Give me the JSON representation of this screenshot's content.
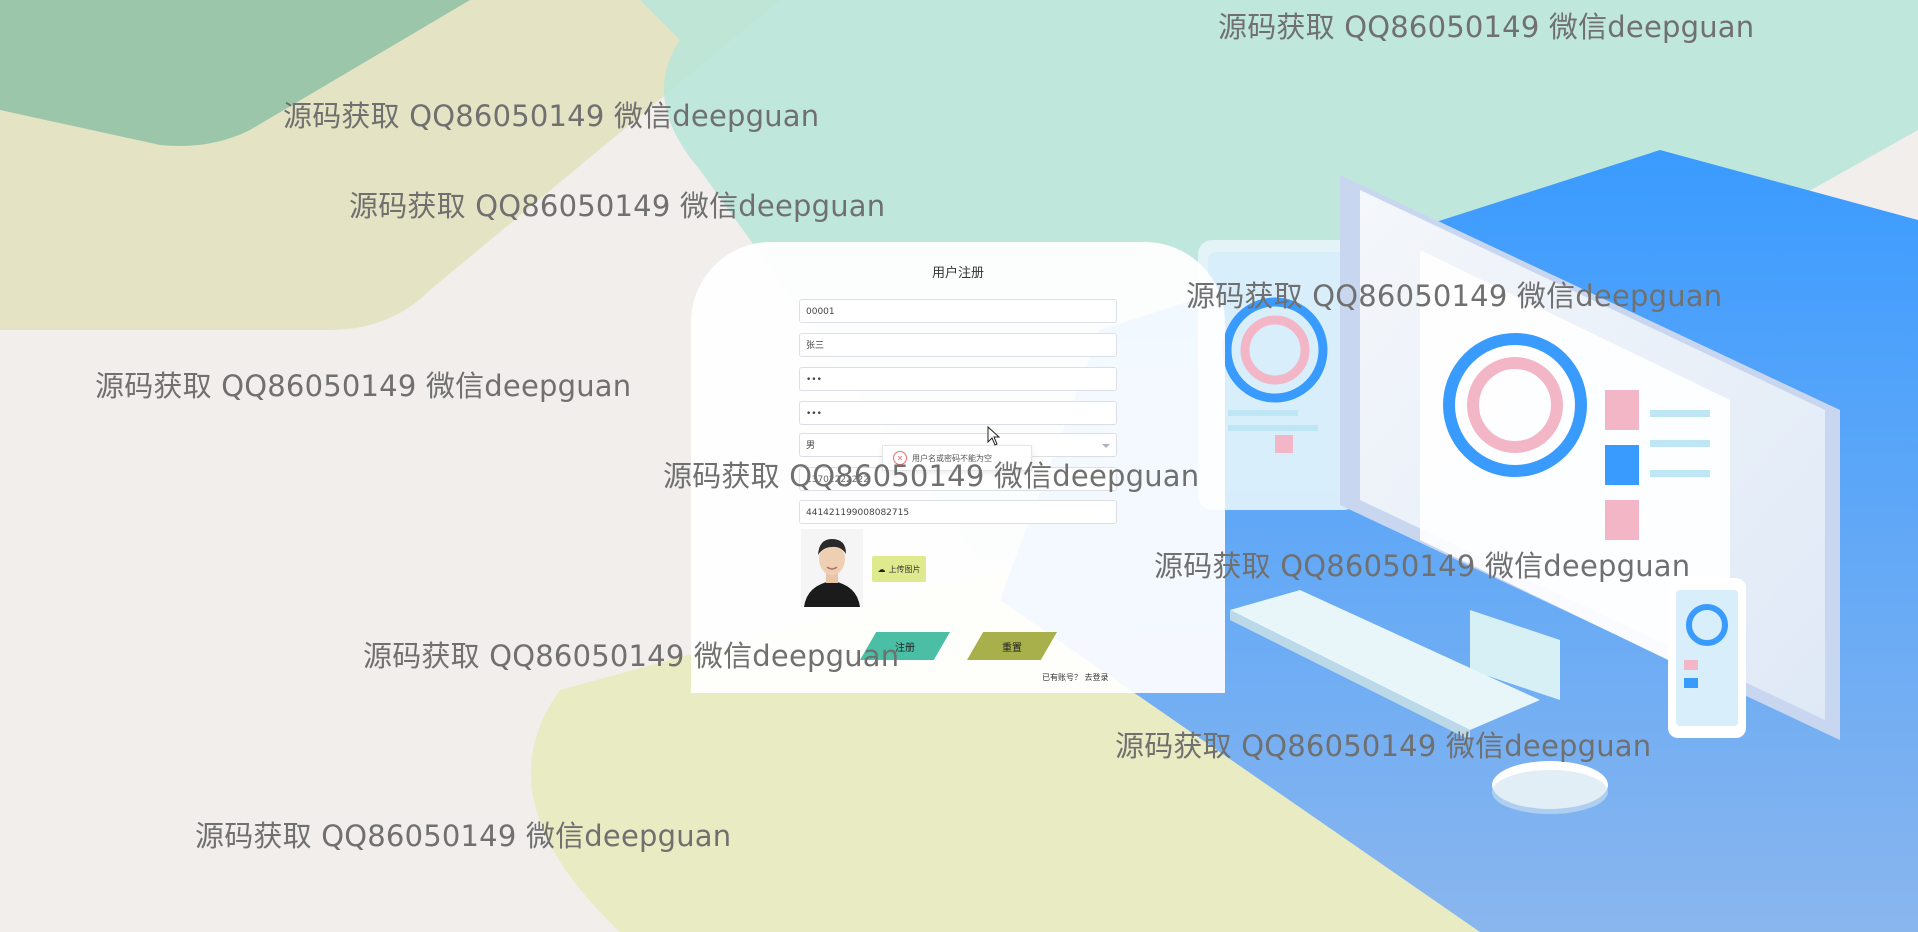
{
  "form": {
    "title": "用户注册",
    "account_value": "00001",
    "name_value": "张三",
    "password_value": "•••",
    "confirm_password_value": "•••",
    "gender_value": "男",
    "phone_value": "13702222222",
    "id_card_value": "441421199008082715",
    "upload_label": "上传图片",
    "register_label": "注册",
    "reset_label": "重置",
    "have_account_text": "已有账号？",
    "go_login_text": "去登录"
  },
  "toast": {
    "message": "用户名或密码不能为空",
    "icon": "error-circle-icon"
  },
  "watermarks": [
    "源码获取 QQ86050149 微信deepguan",
    "源码获取 QQ86050149 微信deepguan",
    "源码获取 QQ86050149 微信deepguan",
    "源码获取 QQ86050149 微信deepguan",
    "源码获取 QQ86050149 微信deepguan",
    "源码获取 QQ86050149 微信deepguan",
    "源码获取 QQ86050149 微信deepguan",
    "源码获取 QQ86050149 微信deepguan",
    "源码获取 QQ86050149 微信deepguan",
    "源码获取 QQ86050149 微信deepguan"
  ],
  "colors": {
    "accent_teal": "#4bbfa5",
    "accent_olive": "#a7b04a",
    "upload_yellow": "#dfe98e",
    "background_blue": "#3a9bff"
  }
}
